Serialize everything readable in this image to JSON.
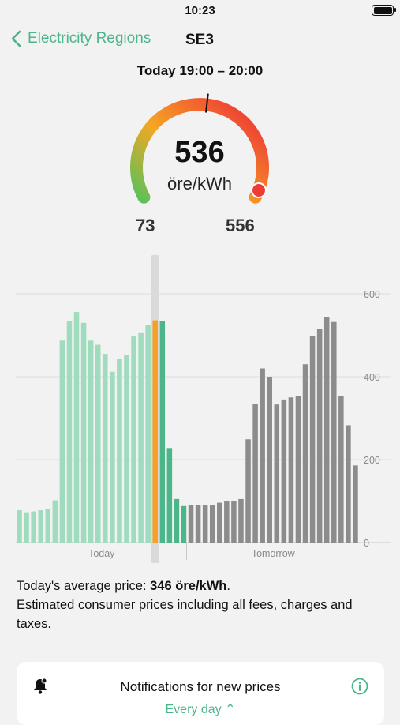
{
  "status": {
    "time": "10:23"
  },
  "nav": {
    "back_label": "Electricity Regions",
    "title": "SE3"
  },
  "period": "Today 19:00 – 20:00",
  "gauge": {
    "value": "536",
    "unit": "öre/kWh",
    "min": "73",
    "max": "556",
    "level": 0.96
  },
  "colors": {
    "accent": "#4db58a",
    "today_bar": "#9fdcbe",
    "current_bar": "#f7a025",
    "upcoming_today_bar": "#4db58a",
    "tomorrow_bar": "#8c8c8c",
    "gauge_low": "#5cc15a",
    "gauge_mid": "#f5a623",
    "gauge_high": "#ef3b36"
  },
  "chart_data": {
    "type": "bar",
    "ylim": [
      0,
      600
    ],
    "yticks": [
      "600",
      "400",
      "200",
      "0"
    ],
    "ytick_values": [
      600,
      400,
      200,
      0
    ],
    "xlabels": [
      "Today",
      "Tomorrow"
    ],
    "current_index": 19,
    "series": [
      {
        "name": "Today",
        "values": [
          78,
          73,
          75,
          78,
          80,
          102,
          487,
          535,
          556,
          530,
          487,
          477,
          455,
          412,
          443,
          452,
          497,
          505,
          524,
          536,
          535,
          228,
          105,
          88
        ]
      },
      {
        "name": "Tomorrow",
        "values": [
          91,
          91,
          91,
          91,
          96,
          99,
          100,
          105,
          249,
          335,
          420,
          400,
          333,
          345,
          350,
          353,
          430,
          498,
          516,
          543,
          532,
          353,
          283,
          186
        ]
      }
    ]
  },
  "info": {
    "avg_prefix": "Today's average price: ",
    "avg_value": "346 öre/kWh",
    "avg_suffix": ".",
    "note": "Estimated consumer prices including all fees, charges and taxes."
  },
  "notifications": {
    "title": "Notifications for new prices",
    "frequency": "Every day ⌃",
    "bell_icon": "bell-badge-icon",
    "info_icon": "info-circle-icon"
  }
}
